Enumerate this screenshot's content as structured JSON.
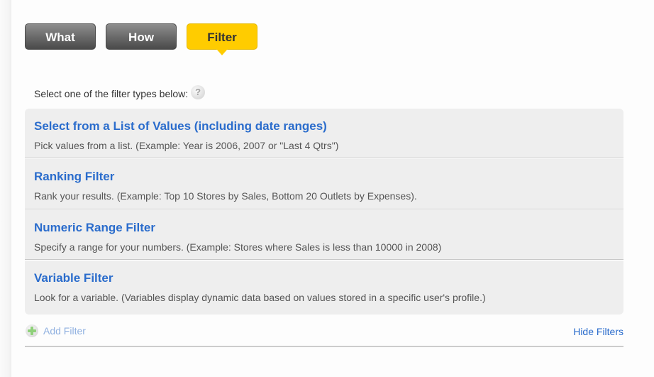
{
  "steps": [
    {
      "label": "What",
      "state": "inactive"
    },
    {
      "label": "How",
      "state": "inactive"
    },
    {
      "label": "Filter",
      "state": "active"
    }
  ],
  "instruction": {
    "text": "Select one of the filter types below:",
    "help_icon": "question-mark-icon",
    "help_glyph": "?"
  },
  "filter_types": [
    {
      "title": "Select from a List of Values (including date ranges)",
      "description": "Pick values from a list. (Example: Year is 2006, 2007 or \"Last 4 Qtrs\")"
    },
    {
      "title": "Ranking Filter",
      "description": "Rank your results. (Example: Top 10 Stores by Sales, Bottom 20 Outlets by Expenses)."
    },
    {
      "title": "Numeric Range Filter",
      "description": "Specify a range for your numbers. (Example: Stores where Sales is less than 10000 in 2008)"
    },
    {
      "title": "Variable Filter",
      "description": "Look for a variable. (Variables display dynamic data based on values stored in a specific user's profile.)"
    }
  ],
  "footer": {
    "add_filter_label": "Add Filter",
    "add_filter_icon": "plus-circle-icon",
    "add_filter_state": "disabled",
    "hide_filters_label": "Hide Filters"
  },
  "colors": {
    "active_step": "#ffcc00",
    "inactive_step": "#6b6b6b",
    "link": "#2a6ccc",
    "disabled_link": "#8fb0e0",
    "list_background": "#eeeeee"
  }
}
